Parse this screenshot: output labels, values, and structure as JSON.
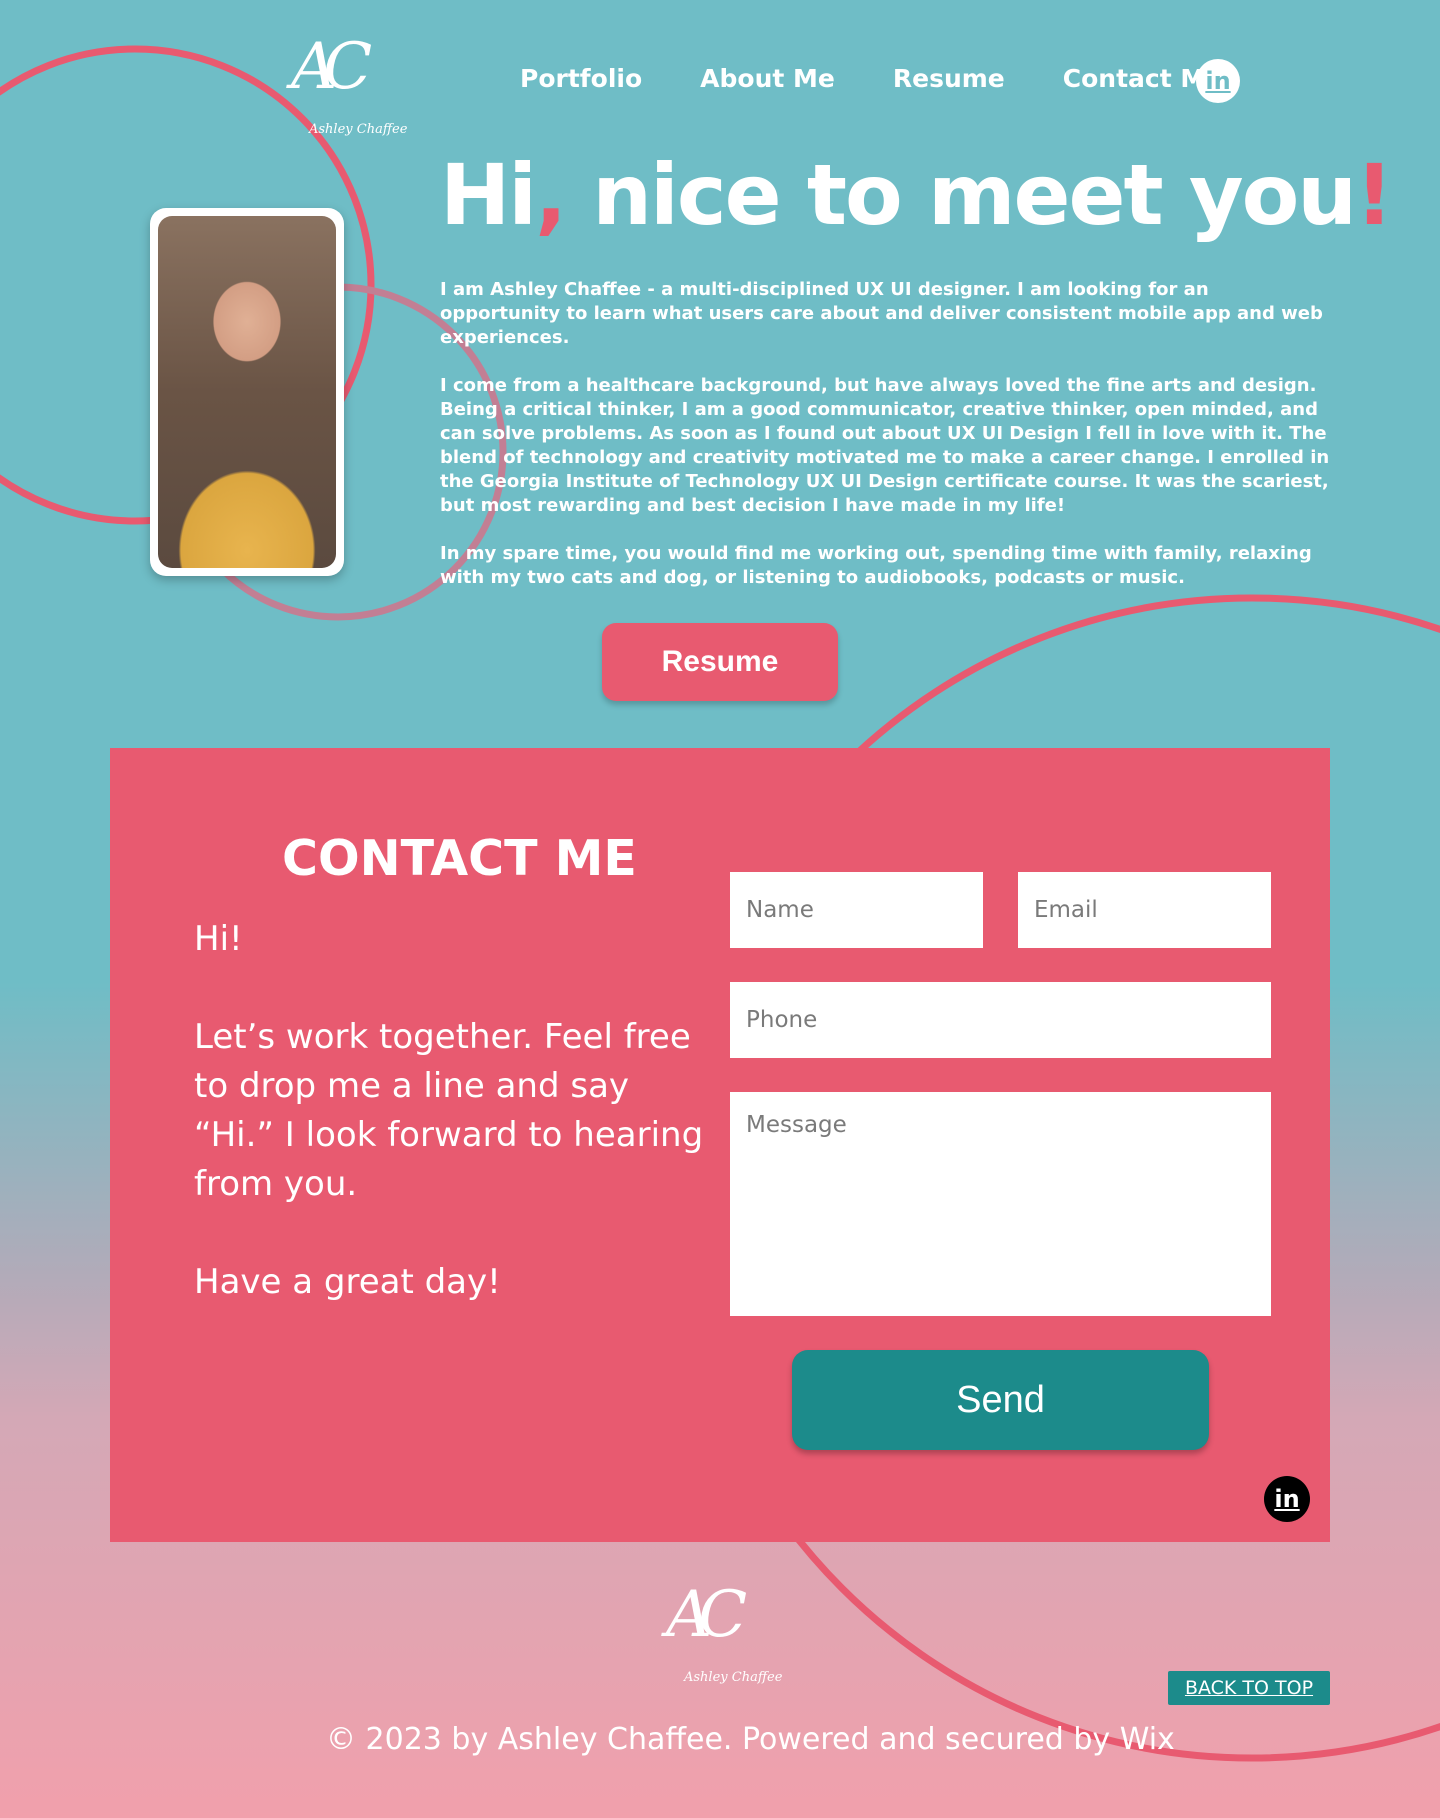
{
  "brand": {
    "monogram": "AC",
    "signature": "Ashley Chaffee"
  },
  "nav": {
    "items": [
      "Portfolio",
      "About Me",
      "Resume",
      "Contact Me"
    ],
    "linkedin_icon": "in"
  },
  "hero": {
    "greeting_a": "Hi",
    "greeting_comma": ",",
    "greeting_b": " nice to meet you",
    "greeting_bang": "!",
    "paragraphs": [
      "I am Ashley Chaffee - a multi-disciplined UX UI designer. I am looking for an opportunity to learn what users care about and deliver consistent mobile app and web experiences.",
      "I come from a healthcare background, but have always loved the fine arts and design. Being a critical thinker, I am a good communicator, creative thinker, open minded, and can solve problems. As soon as I found out about UX UI Design I fell in love with it. The blend of technology and creativity motivated me to make a career change. I enrolled in the Georgia Institute of Technology UX UI Design certificate course. It was the scariest, but most rewarding and best decision I have made in my life!",
      "In my spare time, you would find me working out, spending time with family, relaxing with my two cats and dog, or listening to audiobooks, podcasts or music."
    ],
    "resume_button": "Resume"
  },
  "contact": {
    "title": "CONTACT ME",
    "paragraphs": [
      "Hi!",
      "Let’s work together. Feel free to drop me a line and say “Hi.” I look forward to hearing from you.",
      "Have a great day!"
    ],
    "name_placeholder": "Name",
    "email_placeholder": "Email",
    "phone_placeholder": "Phone",
    "message_placeholder": "Message",
    "send_button": "Send",
    "linkedin_icon": "in"
  },
  "footer": {
    "back_to_top": "BACK TO TOP",
    "copyright": "© 2023 by Ashley Chaffee. Powered and secured by Wix"
  },
  "colors": {
    "teal_bg": "#6fbdc6",
    "pink_accent": "#e85a70",
    "send_teal": "#1c8b8b"
  }
}
